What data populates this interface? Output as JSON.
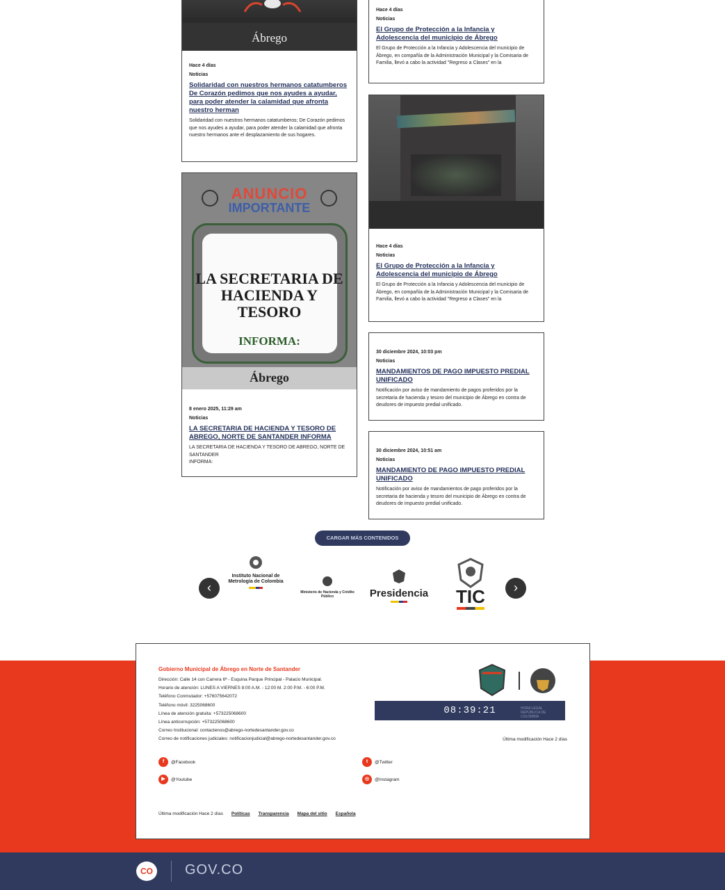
{
  "colors": {
    "accent_red": "#e8391e",
    "navy": "#2f3a5e",
    "link_blue": "#23305a"
  },
  "cards": [
    {
      "date": "Hace 4 días",
      "category": "Noticias",
      "title": "Solidaridad con nuestros hermanos catatumberos De Corazón pedimos que nos ayudes a ayudar, para poder atender la calamidad que afronta nuestro herman",
      "summary": "Solidaridad con nuestros hermanos catatumberos; De Corazón pedimos que nos ayudes a ayudar, para poder atender la calamidad que afronta nuestro hermanos ante el desplazamiento de sus hogares.",
      "image_logo": "Ábrego"
    },
    {
      "date": "Hace 4 días",
      "category": "Noticias",
      "title": "El Grupo de Protección a la Infancia y Adolescencia del municipio de Ábrego",
      "summary": "El Grupo de Protección a la Infancia y Adolescencia del municipio de Ábrego, en compañía de la Administración Municipal y la Comisaria de Familia, llevó a cabo la actividad \"Regreso a Clases\" en la"
    },
    {
      "date": "8 enero 2025, 11:29 am",
      "category": "Noticias",
      "title": "LA SECRETARIA DE HACIENDA Y TESORO DE ABREGO, NORTE DE SANTANDER INFORMA",
      "summary_lines": [
        "LA SECRETARIA DE HACIENDA Y TESORO DE ABREGO, NORTE DE SANTANDER",
        "INFORMA:"
      ],
      "image": {
        "anuncio": "ANUNCIO",
        "importante": "IMPORTANTE",
        "secretaria": "LA SECRETARIA DE HACIENDA Y TESORO",
        "informa": "INFORMA:",
        "logo": "Ábrego"
      }
    },
    {
      "date": "Hace 4 días",
      "category": "Noticias",
      "title": "El Grupo de Protección a la Infancia y Adolescencia del municipio de Ábrego",
      "summary": "El Grupo de Protección a la Infancia y Adolescencia del municipio de Ábrego, en compañía de la Administración Municipal y la Comisaria de Familia, llevó a cabo la actividad \"Regreso a Clases\" en la"
    },
    {
      "date": "30 diciembre 2024, 10:03 pm",
      "category": "Noticias",
      "title": "MANDAMIENTOS DE PAGO IMPUESTO PREDIAL UNIFICADO",
      "summary": "Notificación por aviso de mandamiento de pagos proferidos por la secretaria de hacienda y tesoro del municipio de Ábrego en contra de deudores de impuesto predial unificado."
    },
    {
      "date": "30 diciembre 2024, 10:51 am",
      "category": "Noticias",
      "title": "MANDAMIENTO DE PAGO IMPUESTO PREDIAL UNIFICADO",
      "summary": "Notificación por aviso de mandamientos de pago proferidos por la secretaria de hacienda y tesoro del municipio de Ábrego en contra de deudores de impuesto predial unificado."
    }
  ],
  "load_more": "CARGAR MÁS CONTENIDOS",
  "partners": {
    "prev": "‹",
    "next": "›",
    "metrologia": "Instituto Nacional de Metrología de Colombia",
    "hacienda": "Ministerio de Hacienda y Crédito Público",
    "presidencia": "Presidencia",
    "tic": "TIC"
  },
  "footer": {
    "title": "Gobierno Municipal de Ábrego en Norte de Santander",
    "lines": [
      "Dirección: Calle 14 con Carrera 6ª - Esquina Parque Principal - Palacio Municipal.",
      "Horario de atención: LUNES A VIERNES 8:00 A.M. - 12:00 M. 2:00 P.M. - 6:00 P.M.",
      "Teléfono Conmutador: +576075642072",
      "Teléfono móvil: 3225068600",
      "Línea de atención gratuita: +573225068600",
      "Línea anticorrupción: +573225068600",
      "Correo Institucional: contactenos@abrego-nortedesantander.gov.co",
      "Correo de notificaciones judiciales: notificacionjudicial@abrego-nortedesantander.gov.co"
    ],
    "clock": "08:39:21",
    "clock_note": "HORA LEGAL REPÚBLICA DE COLOMBIA",
    "modified_right": "Última modificación Hace 2 días",
    "social": {
      "facebook": "@Facebook",
      "twitter": "@Twitter",
      "youtube": "@Youtube",
      "instagram": "@Instagram"
    },
    "modified": "Última modificación Hace 2 días",
    "links": [
      "Políticas",
      "Transparencia",
      "Mapa del sitio",
      "Española"
    ]
  },
  "gov_bar": {
    "co": "CO",
    "govco": "GOV.CO"
  }
}
